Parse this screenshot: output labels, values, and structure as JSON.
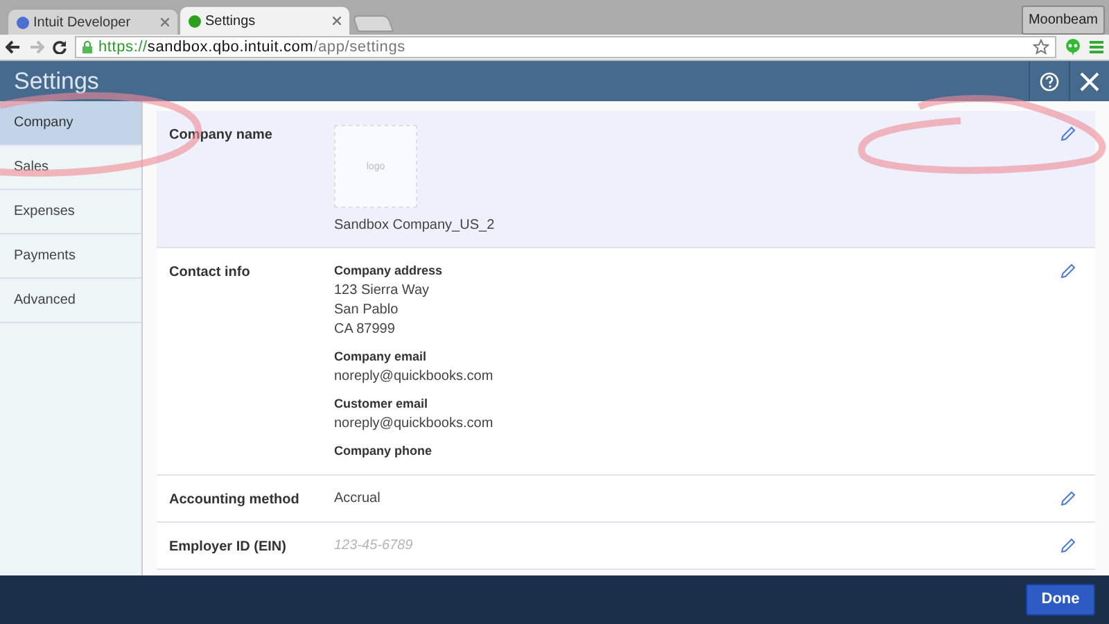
{
  "browser": {
    "tabs": [
      {
        "label": "Intuit Developer",
        "selected": false
      },
      {
        "label": "Settings",
        "selected": true
      }
    ],
    "profile": "Moonbeam",
    "url": {
      "scheme": "https://",
      "host": "sandbox.qbo.intuit.com",
      "path": "/app/settings"
    }
  },
  "header": {
    "title": "Settings"
  },
  "sidebar": {
    "items": [
      {
        "label": "Company",
        "selected": true
      },
      {
        "label": "Sales",
        "selected": false
      },
      {
        "label": "Expenses",
        "selected": false
      },
      {
        "label": "Payments",
        "selected": false
      },
      {
        "label": "Advanced",
        "selected": false
      }
    ]
  },
  "sections": [
    {
      "kind": "logo",
      "label": "Company name",
      "logo_text": "logo",
      "value": "Sandbox Company_US_2",
      "highlighted": true
    },
    {
      "kind": "fields",
      "label": "Contact info",
      "highlighted": false,
      "fields": [
        {
          "label": "Company address",
          "lines": [
            "123 Sierra Way",
            "San Pablo",
            "CA 87999"
          ]
        },
        {
          "label": "Company email",
          "lines": [
            "noreply@quickbooks.com"
          ]
        },
        {
          "label": "Customer email",
          "lines": [
            "noreply@quickbooks.com"
          ]
        },
        {
          "label": "Company phone"
        }
      ]
    },
    {
      "kind": "value",
      "label": "Accounting method",
      "value": "Accrual",
      "highlighted": false
    },
    {
      "kind": "placeholder",
      "label": "Employer ID (EIN)",
      "value": "123-45-6789",
      "highlighted": false
    }
  ],
  "footer": {
    "button": "Done"
  }
}
